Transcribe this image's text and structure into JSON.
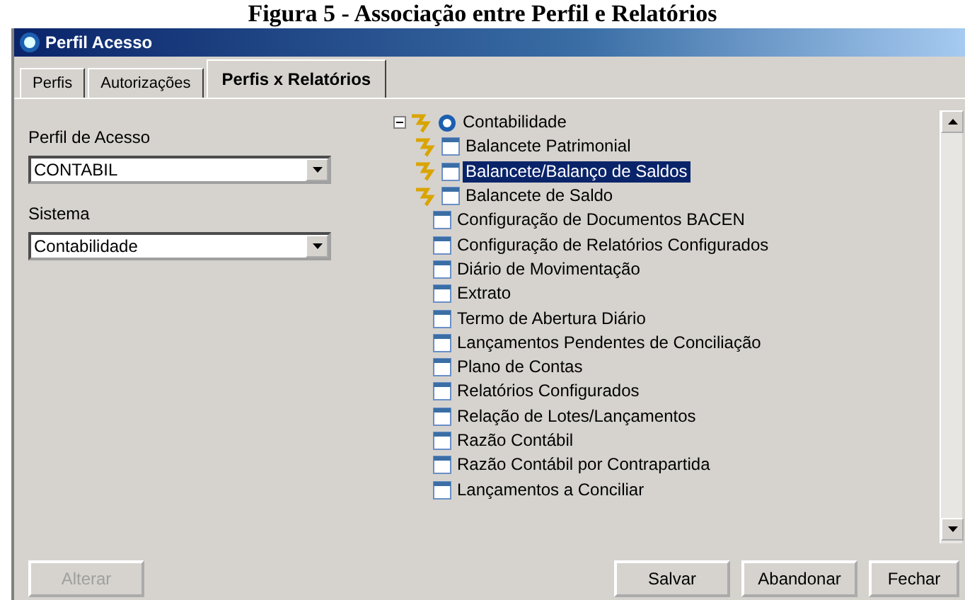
{
  "caption": "Figura 5 - Associação entre Perfil e Relatórios",
  "window": {
    "title": "Perfil Acesso"
  },
  "tabs": [
    {
      "label": "Perfis",
      "selected": false
    },
    {
      "label": "Autorizações",
      "selected": false
    },
    {
      "label": "Perfis x Relatórios",
      "selected": true
    }
  ],
  "fields": [
    {
      "label": "Perfil de Acesso",
      "value": "CONTABIL"
    },
    {
      "label": "Sistema",
      "value": "Contabilidade"
    }
  ],
  "tree": {
    "label": "Contabilidade",
    "expanded": true,
    "granted": true,
    "children": [
      {
        "label": "Balancete Patrimonial",
        "granted": true,
        "selected": false
      },
      {
        "label": "Balancete/Balanço de Saldos",
        "granted": true,
        "selected": true
      },
      {
        "label": "Balancete de Saldo",
        "granted": true,
        "selected": false
      },
      {
        "label": "Configuração de Documentos BACEN",
        "granted": false,
        "selected": false
      },
      {
        "label": "Configuração de Relatórios Configurados",
        "granted": false,
        "selected": false
      },
      {
        "label": "Diário de Movimentação",
        "granted": false,
        "selected": false
      },
      {
        "label": "Extrato",
        "granted": false,
        "selected": false
      },
      {
        "label": "Termo de Abertura Diário",
        "granted": false,
        "selected": false
      },
      {
        "label": "Lançamentos Pendentes de Conciliação",
        "granted": false,
        "selected": false
      },
      {
        "label": "Plano de Contas",
        "granted": false,
        "selected": false
      },
      {
        "label": "Relatórios Configurados",
        "granted": false,
        "selected": false
      },
      {
        "label": "Relação de Lotes/Lançamentos",
        "granted": false,
        "selected": false
      },
      {
        "label": "Razão Contábil",
        "granted": false,
        "selected": false
      },
      {
        "label": "Razão Contábil por Contrapartida",
        "granted": false,
        "selected": false
      },
      {
        "label": "Lançamentos a Conciliar",
        "granted": false,
        "selected": false
      }
    ]
  },
  "buttons": [
    {
      "label": "Alterar",
      "disabled": true
    },
    {
      "label": "Salvar",
      "disabled": false
    },
    {
      "label": "Abandonar",
      "disabled": false
    },
    {
      "label": "Fechar",
      "disabled": false
    }
  ]
}
